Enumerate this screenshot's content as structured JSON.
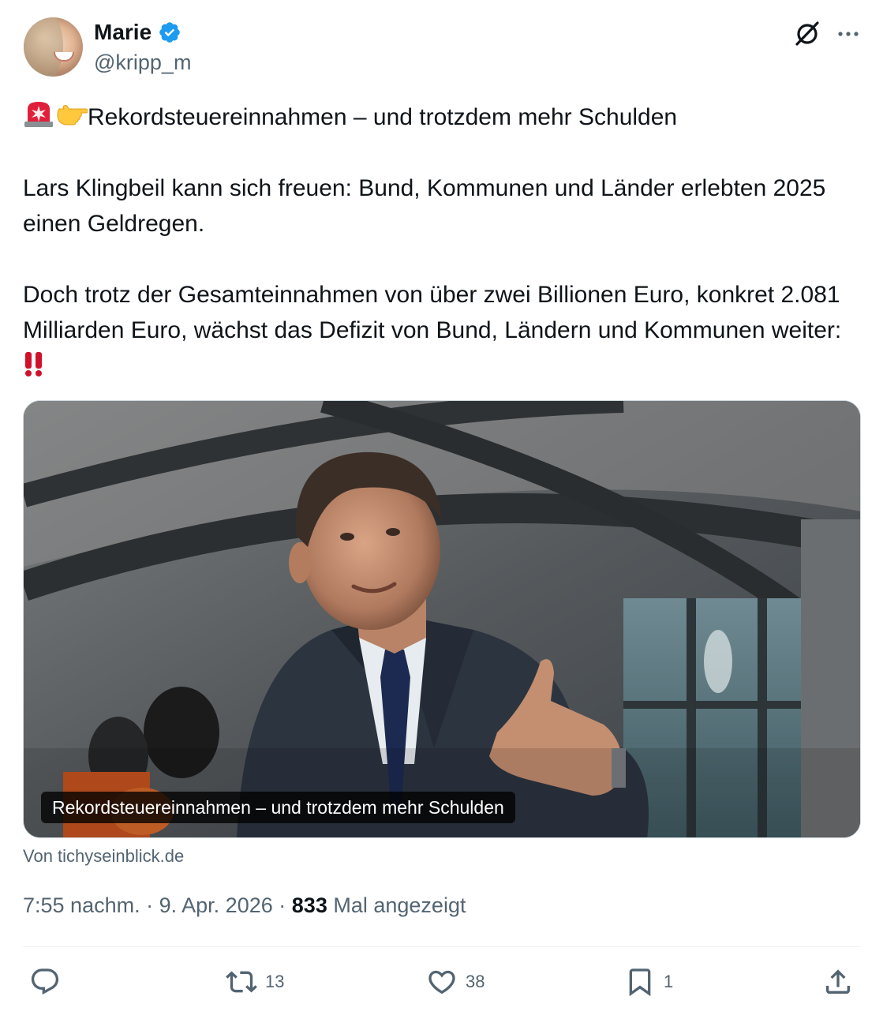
{
  "author": {
    "display_name": "Marie",
    "handle": "@kripp_m",
    "verified": true
  },
  "tweet": {
    "headline": "Rekordsteuereinnahmen – und trotzdem mehr Schulden",
    "paragraph_1": "Lars Klingbeil kann sich freuen: Bund, Kommunen und Länder erlebten 2025 einen Geldregen.",
    "paragraph_2": "Doch trotz der Gesamteinnahmen von über zwei Billionen Euro, konkret 2.081 Milliarden Euro, wächst das Defizit von Bund, Ländern und Kommunen weiter:",
    "emojis": [
      "police-car-light",
      "backhand-index-pointing-right",
      "double-exclamation-mark"
    ]
  },
  "media": {
    "caption": "Rekordsteuereinnahmen – und trotzdem mehr Schulden",
    "source": "Von tichyseinblick.de"
  },
  "meta": {
    "time": "7:55 nachm.",
    "date": "9. Apr. 2026",
    "separator": "·",
    "views_count": "833",
    "views_label": "Mal angezeigt"
  },
  "actions": {
    "reply": "",
    "retweet": "13",
    "like": "38",
    "bookmark": "1"
  },
  "colors": {
    "text_primary": "#0f1419",
    "text_secondary": "#536471",
    "verified_blue": "#1d9bf0",
    "divider": "#eff3f4",
    "siren_red": "#e0203a"
  }
}
